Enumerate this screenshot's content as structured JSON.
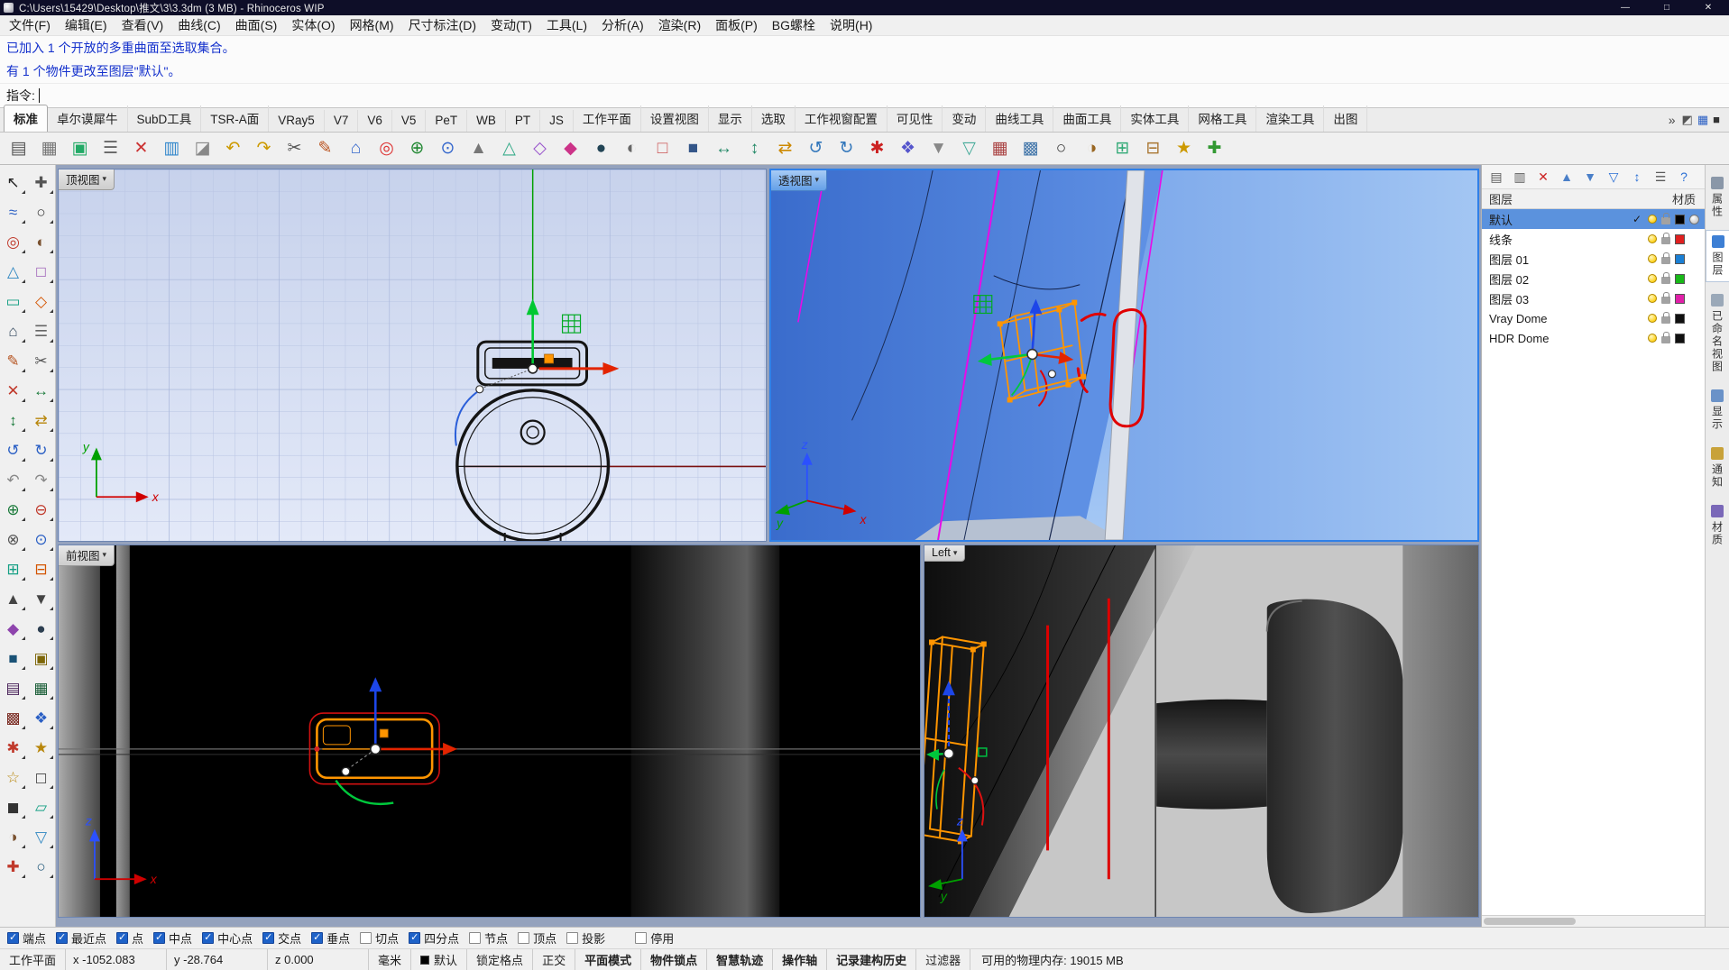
{
  "window": {
    "title": "C:\\Users\\15429\\Desktop\\推文\\3\\3.3dm (3 MB) - Rhinoceros WIP",
    "controls": {
      "minimize": "—",
      "maximize": "□",
      "close": "✕"
    }
  },
  "menu_bar": {
    "items": [
      "文件(F)",
      "编辑(E)",
      "查看(V)",
      "曲线(C)",
      "曲面(S)",
      "实体(O)",
      "网格(M)",
      "尺寸标注(D)",
      "变动(T)",
      "工具(L)",
      "分析(A)",
      "渲染(R)",
      "面板(P)",
      "BG螺栓",
      "说明(H)"
    ]
  },
  "command_area": {
    "line1": "已加入 1 个开放的多重曲面至选取集合。",
    "line2": "有 1 个物件更改至图层\"默认\"。",
    "prompt_label": "指令:"
  },
  "tab_bar": {
    "tabs": [
      {
        "label": "标准",
        "active": true
      },
      {
        "label": "卓尔谟犀牛"
      },
      {
        "label": "SubD工具"
      },
      {
        "label": "TSR-A面"
      },
      {
        "label": "VRay5"
      },
      {
        "label": "V7"
      },
      {
        "label": "V6"
      },
      {
        "label": "V5"
      },
      {
        "label": "PeT"
      },
      {
        "label": "WB"
      },
      {
        "label": "PT"
      },
      {
        "label": "JS"
      },
      {
        "label": "工作平面"
      },
      {
        "label": "设置视图"
      },
      {
        "label": "显示"
      },
      {
        "label": "选取"
      },
      {
        "label": "工作视窗配置"
      },
      {
        "label": "可见性"
      },
      {
        "label": "变动"
      },
      {
        "label": "曲线工具"
      },
      {
        "label": "曲面工具"
      },
      {
        "label": "实体工具"
      },
      {
        "label": "网格工具"
      },
      {
        "label": "渲染工具"
      },
      {
        "label": "出图"
      }
    ],
    "overflow": "»",
    "icons": [
      {
        "g": "◩",
        "c": "#555555"
      },
      {
        "g": "▦",
        "c": "#2a5fc4"
      },
      {
        "g": "■",
        "c": "#333333"
      }
    ]
  },
  "toolbar": {
    "icons": [
      {
        "g": "▤",
        "c": "#555555"
      },
      {
        "g": "▦",
        "c": "#777777"
      },
      {
        "g": "▣",
        "c": "#22aa66"
      },
      {
        "g": "☰",
        "c": "#666666"
      },
      {
        "g": "✕",
        "c": "#cc3333"
      },
      {
        "g": "▥",
        "c": "#3388cc"
      },
      {
        "g": "◪",
        "c": "#888888"
      },
      {
        "g": "↶",
        "c": "#cc9900"
      },
      {
        "g": "↷",
        "c": "#cc9900"
      },
      {
        "g": "✂",
        "c": "#555555"
      },
      {
        "g": "✎",
        "c": "#bb5522"
      },
      {
        "g": "⌂",
        "c": "#3366cc"
      },
      {
        "g": "◎",
        "c": "#dd3333"
      },
      {
        "g": "⊕",
        "c": "#228833"
      },
      {
        "g": "⊙",
        "c": "#3366cc"
      },
      {
        "g": "▲",
        "c": "#777777"
      },
      {
        "g": "△",
        "c": "#33aa88"
      },
      {
        "g": "◇",
        "c": "#9955cc"
      },
      {
        "g": "◆",
        "c": "#cc3388"
      },
      {
        "g": "●",
        "c": "#224455"
      },
      {
        "g": "◐",
        "c": "#666666"
      },
      {
        "g": "□",
        "c": "#cc5555"
      },
      {
        "g": "■",
        "c": "#335588"
      },
      {
        "g": "↔",
        "c": "#228866"
      },
      {
        "g": "↕",
        "c": "#228866"
      },
      {
        "g": "⇄",
        "c": "#cc8800"
      },
      {
        "g": "↺",
        "c": "#3377bb"
      },
      {
        "g": "↻",
        "c": "#3377bb"
      },
      {
        "g": "✱",
        "c": "#cc2222"
      },
      {
        "g": "❖",
        "c": "#5555cc"
      },
      {
        "g": "▼",
        "c": "#888888"
      },
      {
        "g": "▽",
        "c": "#44aa99"
      },
      {
        "g": "▦",
        "c": "#aa4444"
      },
      {
        "g": "▩",
        "c": "#4477aa"
      },
      {
        "g": "○",
        "c": "#333333"
      },
      {
        "g": "◑",
        "c": "#996622"
      },
      {
        "g": "⊞",
        "c": "#33aa77"
      },
      {
        "g": "⊟",
        "c": "#aa7733"
      },
      {
        "g": "★",
        "c": "#cc9900"
      },
      {
        "g": "✚",
        "c": "#339933"
      }
    ]
  },
  "sidebar": {
    "icons": [
      {
        "g": "↖",
        "c": "#222222"
      },
      {
        "g": "✚",
        "c": "#555555"
      },
      {
        "g": "≈",
        "c": "#2a5fc4"
      },
      {
        "g": "○",
        "c": "#333333"
      },
      {
        "g": "◎",
        "c": "#c0392b"
      },
      {
        "g": "◐",
        "c": "#7a5230"
      },
      {
        "g": "△",
        "c": "#2e86c1"
      },
      {
        "g": "□",
        "c": "#8e44ad"
      },
      {
        "g": "▭",
        "c": "#16a085"
      },
      {
        "g": "◇",
        "c": "#d35400"
      },
      {
        "g": "⌂",
        "c": "#34495e"
      },
      {
        "g": "☰",
        "c": "#666666"
      },
      {
        "g": "✎",
        "c": "#b5521e"
      },
      {
        "g": "✂",
        "c": "#555555"
      },
      {
        "g": "✕",
        "c": "#c0392b"
      },
      {
        "g": "↔",
        "c": "#1a7a3a"
      },
      {
        "g": "↕",
        "c": "#1a7a3a"
      },
      {
        "g": "⇄",
        "c": "#b8860b"
      },
      {
        "g": "↺",
        "c": "#2a5fc4"
      },
      {
        "g": "↻",
        "c": "#2a5fc4"
      },
      {
        "g": "↶",
        "c": "#888888"
      },
      {
        "g": "↷",
        "c": "#888888"
      },
      {
        "g": "⊕",
        "c": "#1a7a3a"
      },
      {
        "g": "⊖",
        "c": "#c0392b"
      },
      {
        "g": "⊗",
        "c": "#555555"
      },
      {
        "g": "⊙",
        "c": "#2a5fc4"
      },
      {
        "g": "⊞",
        "c": "#16a085"
      },
      {
        "g": "⊟",
        "c": "#d35400"
      },
      {
        "g": "▲",
        "c": "#444444"
      },
      {
        "g": "▼",
        "c": "#444444"
      },
      {
        "g": "◆",
        "c": "#8e44ad"
      },
      {
        "g": "●",
        "c": "#2c3e50"
      },
      {
        "g": "■",
        "c": "#1a5276"
      },
      {
        "g": "▣",
        "c": "#7d6608"
      },
      {
        "g": "▤",
        "c": "#4a235a"
      },
      {
        "g": "▦",
        "c": "#145a32"
      },
      {
        "g": "▩",
        "c": "#78281f"
      },
      {
        "g": "❖",
        "c": "#2a5fc4"
      },
      {
        "g": "✱",
        "c": "#c0392b"
      },
      {
        "g": "★",
        "c": "#b8860b"
      },
      {
        "g": "☆",
        "c": "#b8860b"
      },
      {
        "g": "◻",
        "c": "#555555"
      },
      {
        "g": "◼",
        "c": "#333333"
      },
      {
        "g": "▱",
        "c": "#16a085"
      },
      {
        "g": "◑",
        "c": "#7a5230"
      },
      {
        "g": "▽",
        "c": "#2e86c1"
      },
      {
        "g": "✚",
        "c": "#c0392b"
      },
      {
        "g": "○",
        "c": "#1a5276"
      }
    ]
  },
  "viewports": {
    "menu_arrow": "▾",
    "axis": {
      "x": "x",
      "y": "y",
      "z": "z"
    },
    "top": {
      "label": "顶视图"
    },
    "perspective": {
      "label": "透视图"
    },
    "front": {
      "label": "前视图"
    },
    "left": {
      "label": "Left"
    }
  },
  "layers_panel": {
    "check_glyph": "✓",
    "toolbar_icons": [
      {
        "name": "new-layer-icon",
        "g": "▤",
        "c": "#5a5a5a"
      },
      {
        "name": "new-sublayer-icon",
        "g": "▥",
        "c": "#5a5a5a"
      },
      {
        "name": "delete-layer-icon",
        "g": "✕",
        "c": "#cc2222"
      },
      {
        "name": "move-up-icon",
        "g": "▲",
        "c": "#4a7fc8"
      },
      {
        "name": "move-down-icon",
        "g": "▼",
        "c": "#4a7fc8"
      },
      {
        "name": "filter-icon",
        "g": "▽",
        "c": "#2a6fd4"
      },
      {
        "name": "sort-icon",
        "g": "↕",
        "c": "#2a6fd4"
      },
      {
        "name": "layer-tools-icon",
        "g": "☰",
        "c": "#5a5a5a"
      },
      {
        "name": "help-icon",
        "g": "?",
        "c": "#2a6fd4"
      }
    ],
    "columns": {
      "layer": "图层",
      "material": "材质"
    },
    "rows": [
      {
        "name": "默认",
        "current": true,
        "selected": true,
        "color": "#000000"
      },
      {
        "name": "线条",
        "color": "#e02020"
      },
      {
        "name": "图层 01",
        "color": "#1a7fd4"
      },
      {
        "name": "图层 02",
        "color": "#18b818"
      },
      {
        "name": "图层 03",
        "color": "#e020a8"
      },
      {
        "name": "Vray Dome",
        "color": "#101010"
      },
      {
        "name": "HDR Dome",
        "color": "#101010"
      }
    ]
  },
  "side_tabs": {
    "tabs": [
      {
        "label": "属性",
        "icon_color": "#8a97a8"
      },
      {
        "label": "图层",
        "icon_color": "#3d7fd4",
        "active": true
      },
      {
        "label": "已命名视图",
        "icon_color": "#9aa8b8"
      },
      {
        "label": "显示",
        "icon_color": "#6a92c8"
      },
      {
        "label": "通知",
        "icon_color": "#c8a23a"
      },
      {
        "label": "材质",
        "icon_color": "#7a68b8"
      }
    ]
  },
  "osnap_bar": {
    "items": [
      {
        "label": "端点",
        "checked": true
      },
      {
        "label": "最近点",
        "checked": true
      },
      {
        "label": "点",
        "checked": true
      },
      {
        "label": "中点",
        "checked": true
      },
      {
        "label": "中心点",
        "checked": true
      },
      {
        "label": "交点",
        "checked": true
      },
      {
        "label": "垂点",
        "checked": true
      },
      {
        "label": "切点",
        "checked": false
      },
      {
        "label": "四分点",
        "checked": true
      },
      {
        "label": "节点",
        "checked": false
      },
      {
        "label": "顶点",
        "checked": false
      },
      {
        "label": "投影",
        "checked": false
      },
      {
        "label": "停用",
        "checked": false,
        "gap": true
      }
    ]
  },
  "status_bar": {
    "cplane": "工作平面",
    "x": "x -1052.083",
    "y": "y -28.764",
    "z": "z 0.000",
    "units": "毫米",
    "layer": "默认",
    "toggles": [
      {
        "label": "锁定格点"
      },
      {
        "label": "正交"
      },
      {
        "label": "平面模式",
        "active": true
      },
      {
        "label": "物件锁点",
        "active": true
      },
      {
        "label": "智慧轨迹",
        "active": true
      },
      {
        "label": "操作轴",
        "active": true
      },
      {
        "label": "记录建构历史",
        "active": true
      },
      {
        "label": "过滤器"
      }
    ],
    "memory": "可用的物理内存: 19015 MB"
  }
}
